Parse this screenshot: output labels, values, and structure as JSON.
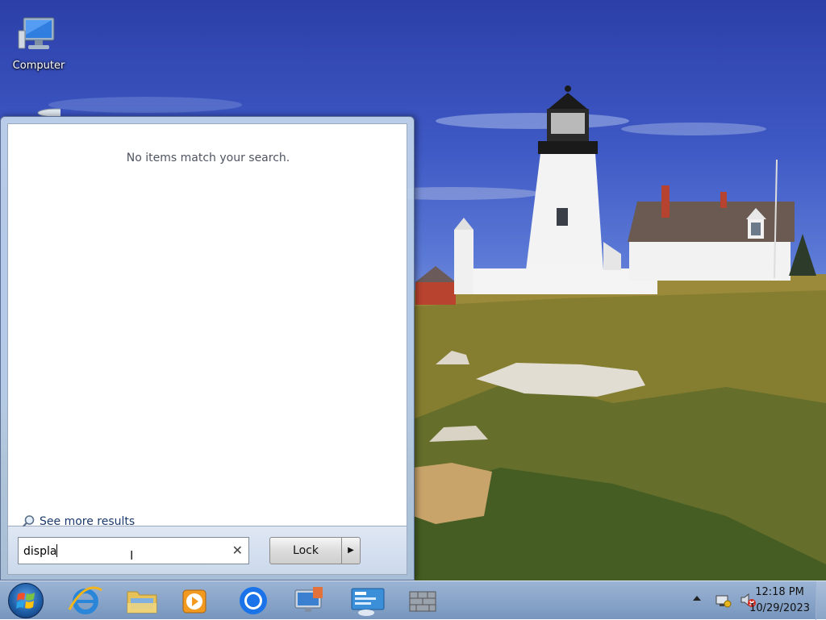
{
  "desktop": {
    "icons": [
      {
        "label": "Computer",
        "icon": "computer-icon"
      },
      {
        "label": "",
        "icon": "recycle-bin-icon"
      }
    ]
  },
  "start_menu": {
    "no_results_message": "No items match your search.",
    "see_more_label": "See more results",
    "search": {
      "value": "displa",
      "clear_icon": "clear-icon"
    },
    "lock_label": "Lock",
    "lock_options_icon": "triangle-right-icon"
  },
  "taskbar": {
    "start_icon": "windows-start-orb-icon",
    "pinned": [
      {
        "name": "internet-explorer",
        "icon": "internet-explorer-icon"
      },
      {
        "name": "file-explorer",
        "icon": "folder-icon"
      },
      {
        "name": "media-player",
        "icon": "media-player-icon"
      },
      {
        "name": "chrome",
        "icon": "chrome-icon"
      },
      {
        "name": "remote-desktop",
        "icon": "remote-desktop-icon"
      },
      {
        "name": "network-tool",
        "icon": "network-app-icon"
      },
      {
        "name": "firewall",
        "icon": "firewall-icon"
      }
    ],
    "tray": {
      "show_hidden_icon": "up-arrow-icon",
      "network_icon": "network-icon",
      "volume_icon": "volume-muted-icon",
      "time": "12:18 PM",
      "date": "10/29/2023"
    }
  },
  "colors": {
    "taskbar": "#7f9dc6",
    "start_menu_panel": "#ffffff",
    "text_muted": "#4e5560",
    "link_text": "#1b3a6b"
  }
}
